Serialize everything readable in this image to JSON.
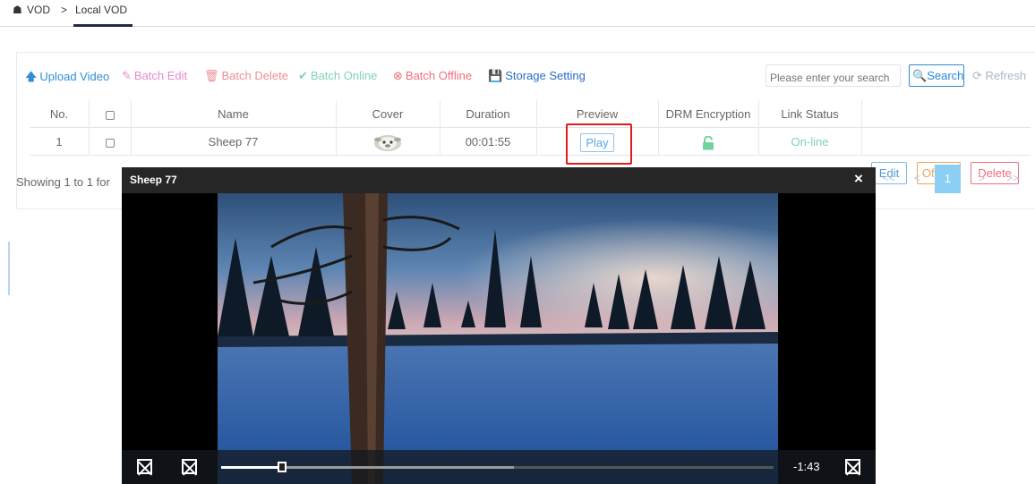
{
  "breadcrumb": {
    "home_icon": "home-icon",
    "root": "VOD",
    "separator": ">",
    "current": "Local VOD"
  },
  "toolbar": {
    "upload": "Upload Video",
    "batch_edit": "Batch Edit",
    "batch_delete": "Batch Delete",
    "batch_online": "Batch Online",
    "batch_offline": "Batch Offline",
    "storage": "Storage Setting",
    "search_placeholder": "Please enter your search",
    "search_label": "Search",
    "refresh_label": "Refresh"
  },
  "table": {
    "headers": [
      "No.",
      "",
      "Name",
      "Cover",
      "Duration",
      "Preview",
      "DRM Encryption",
      "Link Status",
      ""
    ],
    "rows": [
      {
        "no": "1",
        "name": "Sheep 77",
        "duration": "00:01:55",
        "preview": "Play",
        "drm": "unlocked",
        "status": "On-line",
        "edit": "Edit",
        "offline": "Offline",
        "delete": "Delete"
      }
    ]
  },
  "footer": {
    "showing": "Showing 1 to 1 for",
    "pager": {
      "first": "<<",
      "prev": "<",
      "current": "1",
      "next": ">",
      "last": ">>"
    }
  },
  "player": {
    "title": "Sheep 77",
    "close": "×",
    "time_remaining": "-1:43",
    "progress": 0.11,
    "buffered": 0.53
  },
  "colors": {
    "accent": "#2b8ad8",
    "highlight": "#e01b1b",
    "online": "#7fd3b3",
    "offline": "#f5a25a",
    "delete": "#ef6f7d",
    "pager_active": "#8ccff4"
  }
}
